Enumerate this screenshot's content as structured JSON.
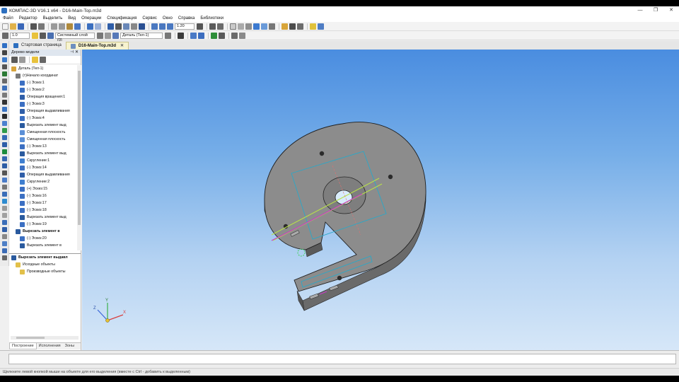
{
  "window": {
    "title": "КОМПАС-3D V16.1 x64 - D16-Main-Top.m3d",
    "minimize": "—",
    "maximize": "❐",
    "close": "✕"
  },
  "menu": [
    "Файл",
    "Редактор",
    "Выделить",
    "Вид",
    "Операции",
    "Спецификация",
    "Сервис",
    "Окно",
    "Справка",
    "Библиотеки"
  ],
  "toolbar": {
    "zoom_value": "1.20",
    "step_value": "1.0",
    "layer_value": "Системный слой (0)",
    "part_value": "Деталь (Тел-1)"
  },
  "tabs": [
    {
      "label": "Стартовая страница",
      "active": false
    },
    {
      "label": "D16-Main-Top.m3d",
      "active": true
    }
  ],
  "tree": {
    "title": "Дерево модели",
    "items": [
      {
        "label": "Деталь (Тел-1)",
        "icon": "part",
        "bold": false,
        "indent": 0
      },
      {
        "label": "(т)Начало координат",
        "icon": "origin",
        "bold": false,
        "indent": 1
      },
      {
        "label": "(-) Эскиз:1",
        "icon": "sketch",
        "bold": false,
        "indent": 2
      },
      {
        "label": "(-) Эскиз:2",
        "icon": "sketch",
        "bold": false,
        "indent": 2
      },
      {
        "label": "Операция вращения:1",
        "icon": "operation",
        "bold": false,
        "indent": 2
      },
      {
        "label": "(-) Эскиз:3",
        "icon": "sketch",
        "bold": false,
        "indent": 2
      },
      {
        "label": "Операция выдавливания",
        "icon": "operation",
        "bold": false,
        "indent": 2
      },
      {
        "label": "(-) Эскиз:4",
        "icon": "sketch",
        "bold": false,
        "indent": 2
      },
      {
        "label": "Вырезать элемент выд",
        "icon": "cut",
        "bold": false,
        "indent": 2
      },
      {
        "label": "Смещенная плоскость",
        "icon": "plane",
        "bold": false,
        "indent": 2
      },
      {
        "label": "Смещенная плоскость",
        "icon": "plane",
        "bold": false,
        "indent": 2
      },
      {
        "label": "(-) Эскиз:13",
        "icon": "sketch",
        "bold": false,
        "indent": 2
      },
      {
        "label": "Вырезать элемент выд",
        "icon": "cut",
        "bold": false,
        "indent": 2
      },
      {
        "label": "Скругление:1",
        "icon": "fillet",
        "bold": false,
        "indent": 2
      },
      {
        "label": "(-) Эскиз:14",
        "icon": "sketch",
        "bold": false,
        "indent": 2
      },
      {
        "label": "Операция выдавливания",
        "icon": "operation",
        "bold": false,
        "indent": 2
      },
      {
        "label": "Скругление:2",
        "icon": "fillet",
        "bold": false,
        "indent": 2
      },
      {
        "label": "(+) Эскиз:15",
        "icon": "sketch",
        "bold": false,
        "indent": 2
      },
      {
        "label": "(-) Эскиз:16",
        "icon": "sketch",
        "bold": false,
        "indent": 2
      },
      {
        "label": "(-) Эскиз:17",
        "icon": "sketch",
        "bold": false,
        "indent": 2
      },
      {
        "label": "(-) Эскиз:18",
        "icon": "sketch",
        "bold": false,
        "indent": 2
      },
      {
        "label": "Вырезать элемент выд",
        "icon": "cut",
        "bold": false,
        "indent": 2
      },
      {
        "label": "(-) Эскиз:19",
        "icon": "sketch",
        "bold": false,
        "indent": 2
      },
      {
        "label": "Вырезать элемент в",
        "icon": "cut",
        "bold": true,
        "indent": 1
      },
      {
        "label": "(-) Эскиз:20",
        "icon": "sketch",
        "bold": false,
        "indent": 2
      },
      {
        "label": "Вырезать элемент в",
        "icon": "cut",
        "bold": false,
        "indent": 2
      }
    ],
    "lower_items": [
      {
        "label": "Вырезать элемент выдавл",
        "icon": "cut",
        "bold": true,
        "indent": 0
      },
      {
        "label": "Исходные объекты",
        "icon": "folder",
        "bold": false,
        "indent": 1
      },
      {
        "label": "Производные объекты",
        "icon": "folder",
        "bold": false,
        "indent": 2
      }
    ],
    "panel_tabs": [
      {
        "label": "Построение",
        "active": true
      },
      {
        "label": "Исполнения",
        "active": false
      },
      {
        "label": "Зоны",
        "active": false
      }
    ]
  },
  "viewport": {
    "axis_x_label": "X",
    "axis_y_label": "Y",
    "axis_z_label": "Z"
  },
  "status": {
    "hint": "Щелкните левой кнопкой мыши на объекте для его выделения (вместе с Ctrl - добавить к выделенным)"
  },
  "colors": {
    "accent": "#2d6fbf",
    "part_fill": "#8c8c8c",
    "sketch_line": "#2aa8c8",
    "selection_line": "#c83cc8",
    "highlight_line": "#b8e04a"
  }
}
